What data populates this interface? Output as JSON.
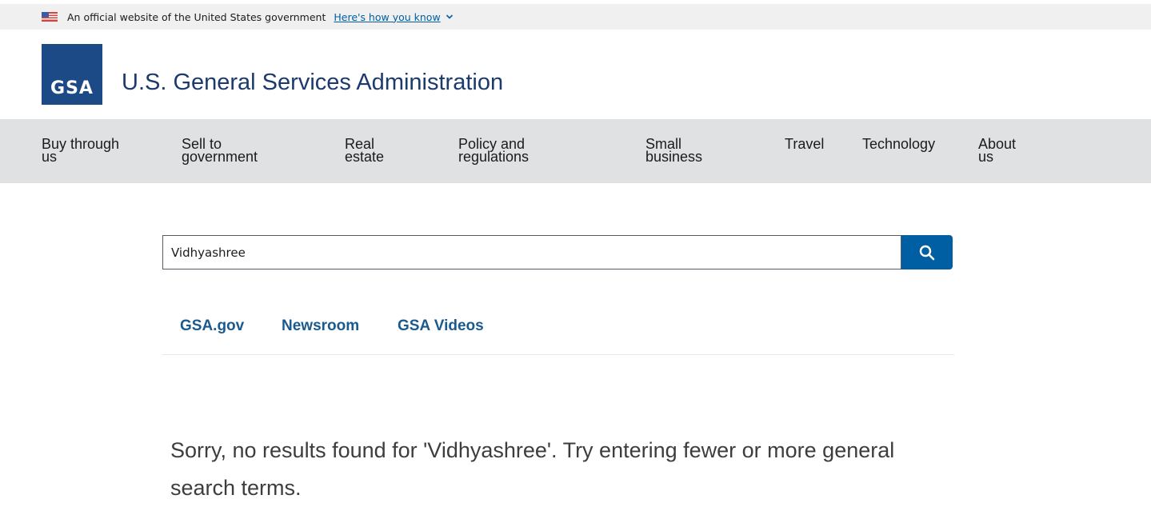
{
  "banner": {
    "text": "An official website of the United States government",
    "link": "Here's how you know",
    "flag_icon": "us-flag-icon",
    "chevron_icon": "chevron-down-icon"
  },
  "header": {
    "logo_text": "GSA",
    "title": "U.S. General Services Administration",
    "logo_color": "#1c4a86"
  },
  "nav": {
    "items": [
      {
        "label": "Buy through\nus"
      },
      {
        "label": "Sell to\ngovernment"
      },
      {
        "label": "Real\nestate"
      },
      {
        "label": "Policy and\nregulations"
      },
      {
        "label": "Small\nbusiness"
      },
      {
        "label": "Travel"
      },
      {
        "label": "Technology"
      },
      {
        "label": "About\nus"
      }
    ]
  },
  "search": {
    "value": "Vidhyashree",
    "button_icon": "search-icon",
    "button_color": "#005ea2"
  },
  "tabs": [
    {
      "label": "GSA.gov"
    },
    {
      "label": "Newsroom"
    },
    {
      "label": "GSA Videos"
    }
  ],
  "results": {
    "message": "Sorry, no results found for 'Vidhyashree'. Try entering fewer or more general search terms."
  }
}
